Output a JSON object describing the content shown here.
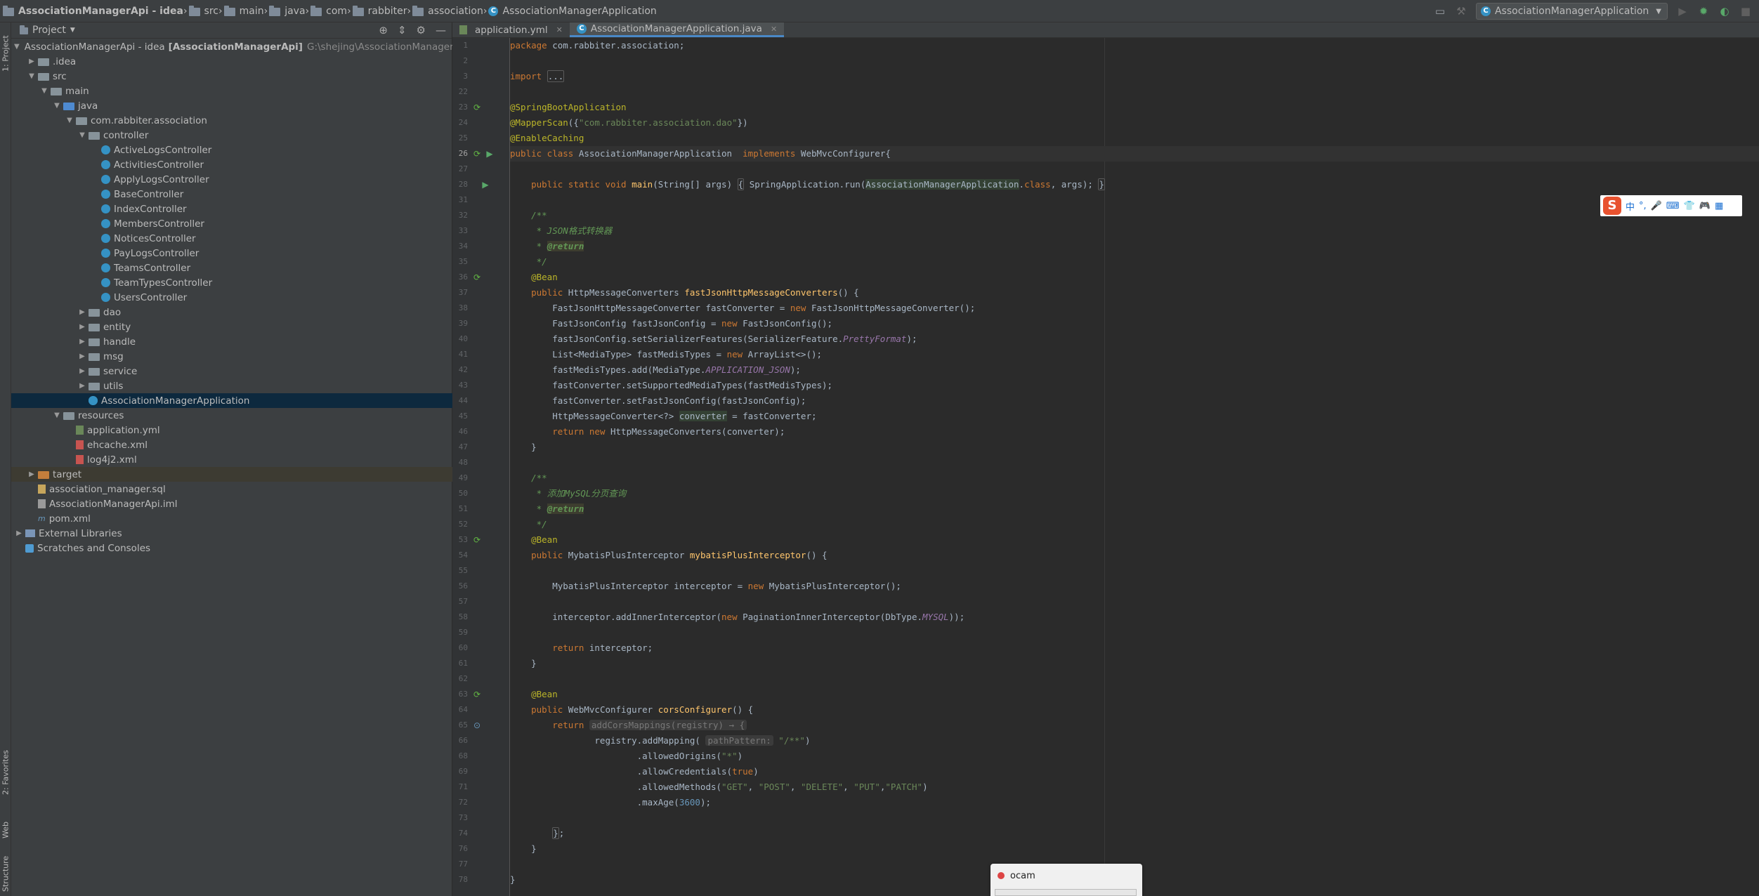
{
  "breadcrumb": [
    {
      "label": "AssociationManagerApi - idea",
      "icon": "folder-icon"
    },
    {
      "label": "src",
      "icon": "folder-icon"
    },
    {
      "label": "main",
      "icon": "folder-icon"
    },
    {
      "label": "java",
      "icon": "folder-icon"
    },
    {
      "label": "com",
      "icon": "folder-icon"
    },
    {
      "label": "rabbiter",
      "icon": "folder-icon"
    },
    {
      "label": "association",
      "icon": "folder-icon"
    },
    {
      "label": "AssociationManagerApplication",
      "icon": "class-icon"
    }
  ],
  "run_config": {
    "label": "AssociationManagerApplication"
  },
  "stripe": {
    "project": "1: Project",
    "favorites": "2: Favorites",
    "web": "Web",
    "structure": "Structure"
  },
  "project_panel": {
    "title": "Project",
    "tree": [
      {
        "label": "AssociationManagerApi - idea",
        "bold": "[AssociationManagerApi]",
        "path": "G:\\shejing\\AssociationManagerApi - idea",
        "depth": 0,
        "toggle": "open",
        "icon": "folder-blue"
      },
      {
        "label": ".idea",
        "depth": 1,
        "toggle": "closed",
        "icon": "folder"
      },
      {
        "label": "src",
        "depth": 1,
        "toggle": "open",
        "icon": "folder"
      },
      {
        "label": "main",
        "depth": 2,
        "toggle": "open",
        "icon": "folder"
      },
      {
        "label": "java",
        "depth": 3,
        "toggle": "open",
        "icon": "folder-blue"
      },
      {
        "label": "com.rabbiter.association",
        "depth": 4,
        "toggle": "open",
        "icon": "folder-pkg"
      },
      {
        "label": "controller",
        "depth": 5,
        "toggle": "open",
        "icon": "folder-pkg"
      },
      {
        "label": "ActiveLogsController",
        "depth": 6,
        "toggle": "",
        "icon": "class"
      },
      {
        "label": "ActivitiesController",
        "depth": 6,
        "toggle": "",
        "icon": "class"
      },
      {
        "label": "ApplyLogsController",
        "depth": 6,
        "toggle": "",
        "icon": "class"
      },
      {
        "label": "BaseController",
        "depth": 6,
        "toggle": "",
        "icon": "class"
      },
      {
        "label": "IndexController",
        "depth": 6,
        "toggle": "",
        "icon": "class"
      },
      {
        "label": "MembersController",
        "depth": 6,
        "toggle": "",
        "icon": "class"
      },
      {
        "label": "NoticesController",
        "depth": 6,
        "toggle": "",
        "icon": "class"
      },
      {
        "label": "PayLogsController",
        "depth": 6,
        "toggle": "",
        "icon": "class"
      },
      {
        "label": "TeamsController",
        "depth": 6,
        "toggle": "",
        "icon": "class"
      },
      {
        "label": "TeamTypesController",
        "depth": 6,
        "toggle": "",
        "icon": "class"
      },
      {
        "label": "UsersController",
        "depth": 6,
        "toggle": "",
        "icon": "class"
      },
      {
        "label": "dao",
        "depth": 5,
        "toggle": "closed",
        "icon": "folder-pkg"
      },
      {
        "label": "entity",
        "depth": 5,
        "toggle": "closed",
        "icon": "folder-pkg"
      },
      {
        "label": "handle",
        "depth": 5,
        "toggle": "closed",
        "icon": "folder-pkg"
      },
      {
        "label": "msg",
        "depth": 5,
        "toggle": "closed",
        "icon": "folder-pkg"
      },
      {
        "label": "service",
        "depth": 5,
        "toggle": "closed",
        "icon": "folder-pkg"
      },
      {
        "label": "utils",
        "depth": 5,
        "toggle": "closed",
        "icon": "folder-pkg"
      },
      {
        "label": "AssociationManagerApplication",
        "depth": 5,
        "toggle": "",
        "icon": "class-main",
        "selected": true
      },
      {
        "label": "resources",
        "depth": 3,
        "toggle": "open",
        "icon": "folder-res"
      },
      {
        "label": "application.yml",
        "depth": 4,
        "toggle": "",
        "icon": "file-yml"
      },
      {
        "label": "ehcache.xml",
        "depth": 4,
        "toggle": "",
        "icon": "file-xml"
      },
      {
        "label": "log4j2.xml",
        "depth": 4,
        "toggle": "",
        "icon": "file-xml"
      },
      {
        "label": "target",
        "depth": 1,
        "toggle": "closed",
        "icon": "folder-orange",
        "excluded": true
      },
      {
        "label": "association_manager.sql",
        "depth": 1,
        "toggle": "",
        "icon": "file-sql"
      },
      {
        "label": "AssociationManagerApi.iml",
        "depth": 1,
        "toggle": "",
        "icon": "file-iml"
      },
      {
        "label": "pom.xml",
        "depth": 1,
        "toggle": "",
        "icon": "file-pom"
      },
      {
        "label": "External Libraries",
        "depth": 0,
        "toggle": "closed",
        "icon": "lib"
      },
      {
        "label": "Scratches and Consoles",
        "depth": 0,
        "toggle": "",
        "icon": "scratch"
      }
    ]
  },
  "tabs": [
    {
      "label": "application.yml",
      "active": false,
      "icon": "yaml-icon"
    },
    {
      "label": "AssociationManagerApplication.java",
      "active": true,
      "icon": "class-icon"
    }
  ],
  "editor": {
    "current_line": "26",
    "lines": [
      {
        "n": "1",
        "html": "<span class=\"kw\">package</span> com.rabbiter.association;"
      },
      {
        "n": "2",
        "html": ""
      },
      {
        "n": "3",
        "html": "<span class=\"kw\">import</span> <span class=\"fold-box\">...</span>"
      },
      {
        "n": "22",
        "html": ""
      },
      {
        "n": "23",
        "html": "<span class=\"an\">@SpringBootApplication</span>",
        "gutter": "bean"
      },
      {
        "n": "24",
        "html": "<span class=\"an\">@MapperScan</span>({<span class=\"str\">\"com.rabbiter.association.dao\"</span>})"
      },
      {
        "n": "25",
        "html": "<span class=\"an\">@EnableCaching</span>"
      },
      {
        "n": "26",
        "html": "<span class=\"kw\">public class</span> AssociationManagerApplication  <span class=\"kw\">implements</span> WebMvcConfigurer{",
        "gutter": "bean-run"
      },
      {
        "n": "27",
        "html": ""
      },
      {
        "n": "28",
        "html": "    <span class=\"kw\">public static void</span> <span class=\"fn\">main</span>(String[] args) <span class=\"fold-box\">{</span> SpringApplication.<span>run</span>(<span class=\"hl\">AssociationManagerApplication</span>.<span class=\"kw\">class</span>, args); <span class=\"fold-box\">}</span>",
        "gutter": "run"
      },
      {
        "n": "31",
        "html": ""
      },
      {
        "n": "32",
        "html": "    <span class=\"cm\">/**</span>"
      },
      {
        "n": "33",
        "html": "<span class=\"cm\">     * JSON格式转换器</span>"
      },
      {
        "n": "34",
        "html": "<span class=\"cm\">     * </span><span class=\"tag\">@return</span>"
      },
      {
        "n": "35",
        "html": "<span class=\"cm\">     */</span>"
      },
      {
        "n": "36",
        "html": "    <span class=\"an\">@Bean</span>",
        "gutter": "bean"
      },
      {
        "n": "37",
        "html": "    <span class=\"kw\">public</span> HttpMessageConverters <span class=\"fn\">fastJsonHttpMessageConverters</span>() {"
      },
      {
        "n": "38",
        "html": "        FastJsonHttpMessageConverter fastConverter = <span class=\"kw\">new</span> FastJsonHttpMessageConverter();"
      },
      {
        "n": "39",
        "html": "        FastJsonConfig fastJsonConfig = <span class=\"kw\">new</span> FastJsonConfig();"
      },
      {
        "n": "40",
        "html": "        fastJsonConfig.setSerializerFeatures(SerializerFeature.<span class=\"st\">PrettyFormat</span>);"
      },
      {
        "n": "41",
        "html": "        List&lt;MediaType&gt; fastMedisTypes = <span class=\"kw\">new</span> ArrayList&lt;&gt;();"
      },
      {
        "n": "42",
        "html": "        fastMedisTypes.add(MediaType.<span class=\"st\">APPLICATION_JSON</span>);"
      },
      {
        "n": "43",
        "html": "        fastConverter.setSupportedMediaTypes(fastMedisTypes);"
      },
      {
        "n": "44",
        "html": "        fastConverter.setFastJsonConfig(fastJsonConfig);"
      },
      {
        "n": "45",
        "html": "        HttpMessageConverter&lt;?&gt; <span class=\"hl\">converter</span> = fastConverter;"
      },
      {
        "n": "46",
        "html": "        <span class=\"kw\">return new</span> HttpMessageConverters(converter);"
      },
      {
        "n": "47",
        "html": "    }"
      },
      {
        "n": "48",
        "html": ""
      },
      {
        "n": "49",
        "html": "    <span class=\"cm\">/**</span>"
      },
      {
        "n": "50",
        "html": "<span class=\"cm\">     * 添加MySQL分页查询</span>"
      },
      {
        "n": "51",
        "html": "<span class=\"cm\">     * </span><span class=\"tag\">@return</span>"
      },
      {
        "n": "52",
        "html": "<span class=\"cm\">     */</span>"
      },
      {
        "n": "53",
        "html": "    <span class=\"an\">@Bean</span>",
        "gutter": "bean"
      },
      {
        "n": "54",
        "html": "    <span class=\"kw\">public</span> MybatisPlusInterceptor <span class=\"fn\">mybatisPlusInterceptor</span>() {"
      },
      {
        "n": "55",
        "html": ""
      },
      {
        "n": "56",
        "html": "        MybatisPlusInterceptor interceptor = <span class=\"kw\">new</span> MybatisPlusInterceptor();"
      },
      {
        "n": "57",
        "html": ""
      },
      {
        "n": "58",
        "html": "        interceptor.addInnerInterceptor(<span class=\"kw\">new</span> PaginationInnerInterceptor(DbType.<span class=\"st\">MYSQL</span>));"
      },
      {
        "n": "59",
        "html": ""
      },
      {
        "n": "60",
        "html": "        <span class=\"kw\">return</span> interceptor;"
      },
      {
        "n": "61",
        "html": "    }"
      },
      {
        "n": "62",
        "html": ""
      },
      {
        "n": "63",
        "html": "    <span class=\"an\">@Bean</span>",
        "gutter": "bean"
      },
      {
        "n": "64",
        "html": "    <span class=\"kw\">public</span> WebMvcConfigurer <span class=\"fn\">corsConfigurer</span>() {"
      },
      {
        "n": "65",
        "html": "        <span class=\"kw\">return</span> <span class=\"hint\">addCorsMappings(registry) → {</span>",
        "gutter": "impl"
      },
      {
        "n": "66",
        "html": "                registry.addMapping( <span class=\"hint\">pathPattern:</span> <span class=\"str\">\"/**\"</span>)"
      },
      {
        "n": "68",
        "html": "                        .allowedOrigins(<span class=\"str\">\"*\"</span>)"
      },
      {
        "n": "69",
        "html": "                        .allowCredentials(<span class=\"kw\">true</span>)"
      },
      {
        "n": "71",
        "html": "                        .allowedMethods(<span class=\"str\">\"GET\"</span>, <span class=\"str\">\"POST\"</span>, <span class=\"str\">\"DELETE\"</span>, <span class=\"str\">\"PUT\"</span>,<span class=\"str\">\"PATCH\"</span>)"
      },
      {
        "n": "72",
        "html": "                        .maxAge(<span class=\"num\">3600</span>);"
      },
      {
        "n": "73",
        "html": ""
      },
      {
        "n": "74",
        "html": "        <span class=\"fold-box\">}</span>;"
      },
      {
        "n": "76",
        "html": "    }"
      },
      {
        "n": "77",
        "html": ""
      },
      {
        "n": "78",
        "html": "}"
      }
    ]
  },
  "ime": {
    "logo": "S",
    "mode": "中",
    "punct": "°,",
    "voice": "mic-icon",
    "keyboard": "keyboard-icon",
    "skin": "skin-icon",
    "game": "game-icon",
    "apps": "apps-icon"
  },
  "ocam": {
    "title": "ocam"
  }
}
